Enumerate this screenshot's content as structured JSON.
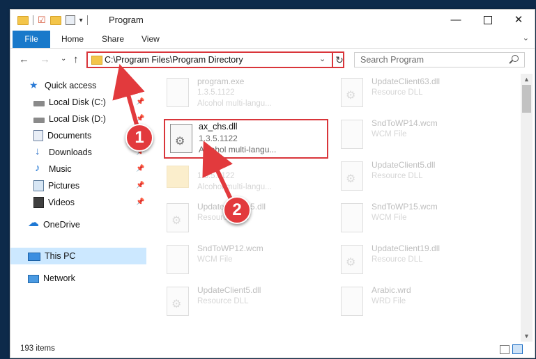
{
  "window": {
    "title": "Program",
    "controls": {
      "minimize": "—",
      "maximize": "",
      "close": "✕"
    }
  },
  "ribbon": {
    "tabs": [
      "File",
      "Home",
      "Share",
      "View"
    ],
    "expand": "⌄"
  },
  "nav": {
    "back": "←",
    "forward": "→",
    "recent": "⌄",
    "up": "↑",
    "address": "C:\\Program Files\\Program Directory",
    "address_dropdown": "⌄",
    "refresh": "↻",
    "search_placeholder": "Search Program"
  },
  "sidebar": {
    "items": [
      {
        "label": "Quick access",
        "icon": "star-icon"
      },
      {
        "label": "Local Disk (C:)",
        "icon": "disk-icon",
        "pinned": true
      },
      {
        "label": "Local Disk (D:)",
        "icon": "disk-icon",
        "pinned": true
      },
      {
        "label": "Documents",
        "icon": "documents-icon",
        "pinned": true
      },
      {
        "label": "Downloads",
        "icon": "downloads-icon",
        "pinned": true
      },
      {
        "label": "Music",
        "icon": "music-icon",
        "pinned": true
      },
      {
        "label": "Pictures",
        "icon": "pictures-icon",
        "pinned": true
      },
      {
        "label": "Videos",
        "icon": "videos-icon",
        "pinned": true
      },
      {
        "label": "OneDrive",
        "icon": "cloud-icon"
      },
      {
        "label": "This PC",
        "icon": "computer-icon",
        "selected": true
      },
      {
        "label": "Network",
        "icon": "network-icon"
      }
    ]
  },
  "files": [
    {
      "name": "program.exe",
      "line1": "1.3.5.1122",
      "line2": "Alcohol multi-langu..."
    },
    {
      "name": "UpdateClient63.dll",
      "line1": "Resource DLL",
      "line2": ""
    },
    {
      "name": "SndToWP14.wcm",
      "line1": "WCM File",
      "line2": ""
    },
    {
      "name": "",
      "line1": "1.3.5.1122",
      "line2": "Alcohol multi-langu..."
    },
    {
      "name": "UpdateClient5.dll",
      "line1": "Resource DLL",
      "line2": ""
    },
    {
      "name": "UpdateClient65.dll",
      "line1": "Resource DLL",
      "line2": ""
    },
    {
      "name": "SndToWP15.wcm",
      "line1": "WCM File",
      "line2": ""
    },
    {
      "name": "SndToWP12.wcm",
      "line1": "WCM File",
      "line2": ""
    },
    {
      "name": "UpdateClient19.dll",
      "line1": "Resource DLL",
      "line2": ""
    },
    {
      "name": "UpdateClient5.dll",
      "line1": "Resource DLL",
      "line2": ""
    },
    {
      "name": "Arabic.wrd",
      "line1": "WRD File",
      "line2": ""
    }
  ],
  "highlighted_file": {
    "name": "ax_chs.dll",
    "line1": "1.3.5.1122",
    "line2": "Alcohol multi-langu..."
  },
  "annotations": {
    "step1": "1",
    "step2": "2",
    "color": "#e23a3d"
  },
  "status": {
    "item_count": "193 items"
  }
}
